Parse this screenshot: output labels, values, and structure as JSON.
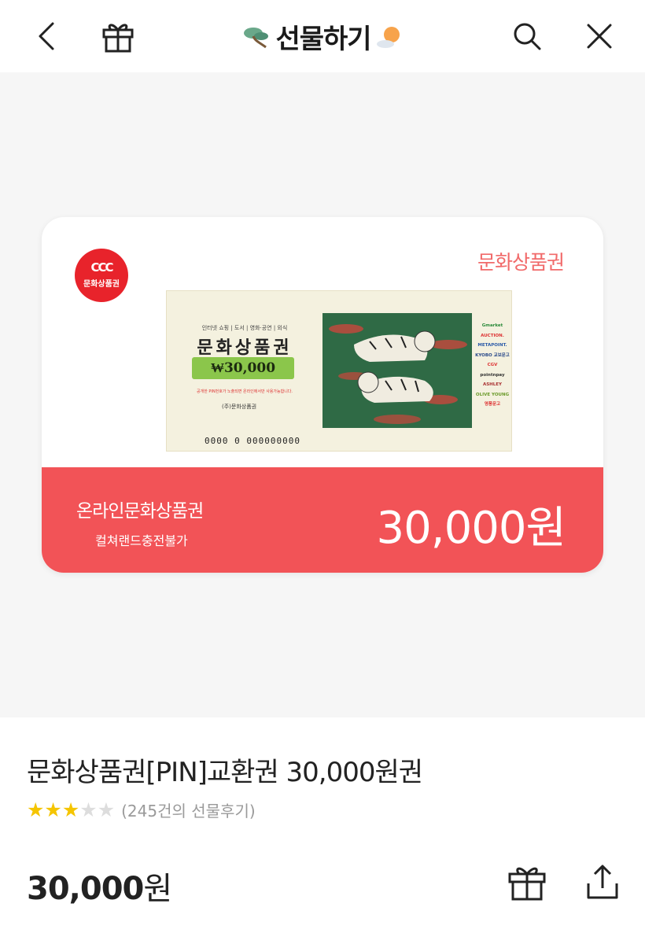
{
  "header": {
    "title": "선물하기"
  },
  "card": {
    "logo_text": "문화상품권",
    "brand_label": "문화상품권",
    "voucher": {
      "categories": "인터넷 쇼핑 | 도서 | 영화·공연 | 외식",
      "title": "문화상품권",
      "amount": "₩30,000",
      "notice": "공개한 PIN번호가 노출되면 온라인에서만 사용가능합니다.",
      "issuer": "(주)문화상품권",
      "serial": "0000 0 000000000",
      "brands": [
        "Gmarket",
        "AUCTION.",
        "METAPOINT.",
        "KYOBO 교보문고",
        "CGV",
        "pointnpay",
        "ASHLEY",
        "OLIVE YOUNG",
        "영풍문고"
      ]
    },
    "band_line1": "온라인문화상품권",
    "band_line2": "컬쳐랜드충전불가",
    "band_price": "30,000원"
  },
  "product": {
    "title": "문화상품권[PIN]교환권 30,000원권",
    "rating": 3,
    "rating_max": 5,
    "review_text": "(245건의 선물후기)",
    "price_amount": "30,000",
    "price_unit": "원"
  },
  "colors": {
    "accent": "#f25357",
    "star_on": "#f5c500",
    "star_off": "#dddddd"
  }
}
